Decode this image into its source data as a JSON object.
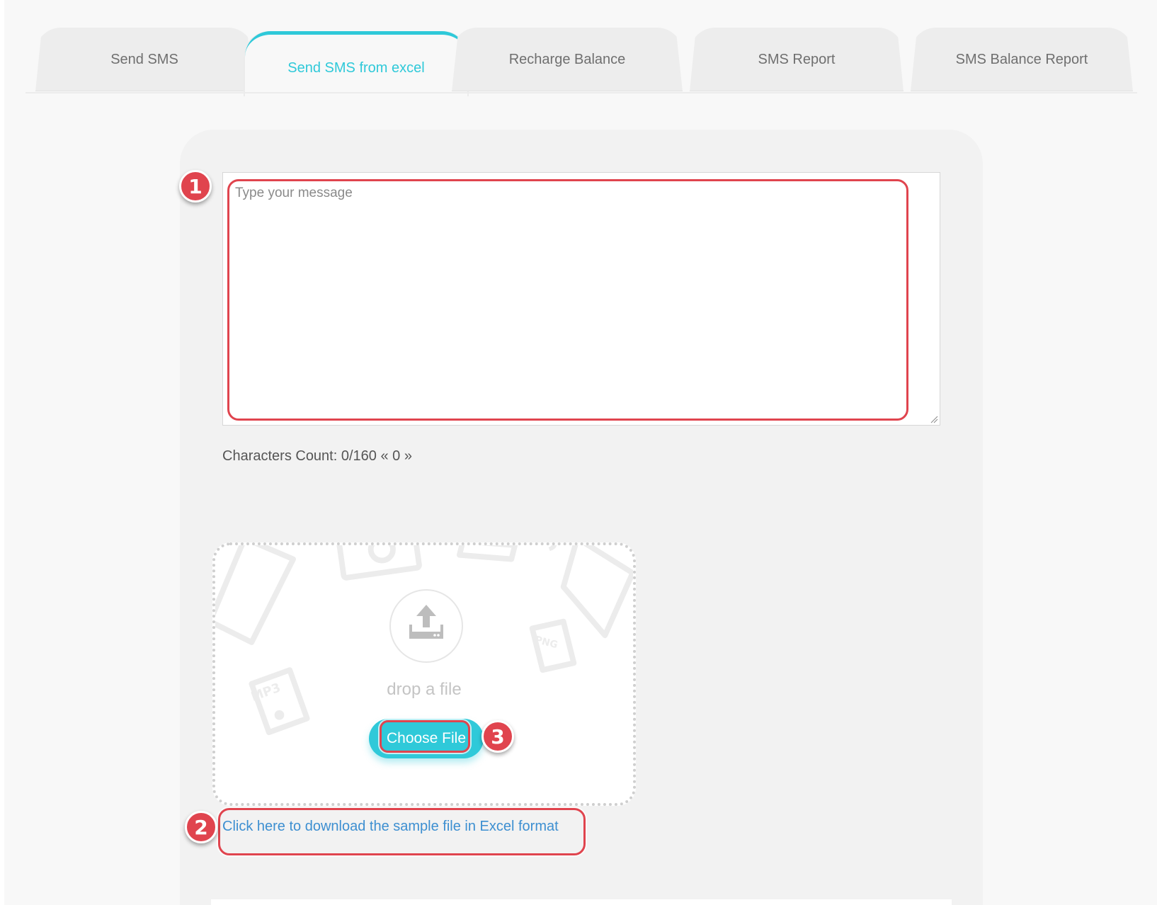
{
  "tabs": [
    {
      "label": "Send SMS",
      "active": false
    },
    {
      "label": "Send SMS from excel",
      "active": true
    },
    {
      "label": "Recharge Balance",
      "active": false
    },
    {
      "label": "SMS Report",
      "active": false
    },
    {
      "label": "SMS Balance Report",
      "active": false
    }
  ],
  "message": {
    "placeholder": "Type your message",
    "value": ""
  },
  "characters_count": "Characters Count: 0/160 « 0 »",
  "dropzone": {
    "icon": "upload-icon",
    "label": "drop a file",
    "button_label": "Choose File"
  },
  "download_link": "Click here to download the sample file in Excel format",
  "annotations": [
    {
      "number": "1",
      "target": "message-textarea"
    },
    {
      "number": "2",
      "target": "download-sample-link"
    },
    {
      "number": "3",
      "target": "choose-file-button"
    }
  ],
  "colors": {
    "accent": "#2fc9d9",
    "annotation": "#e0444e",
    "link": "#3d8fd1"
  }
}
